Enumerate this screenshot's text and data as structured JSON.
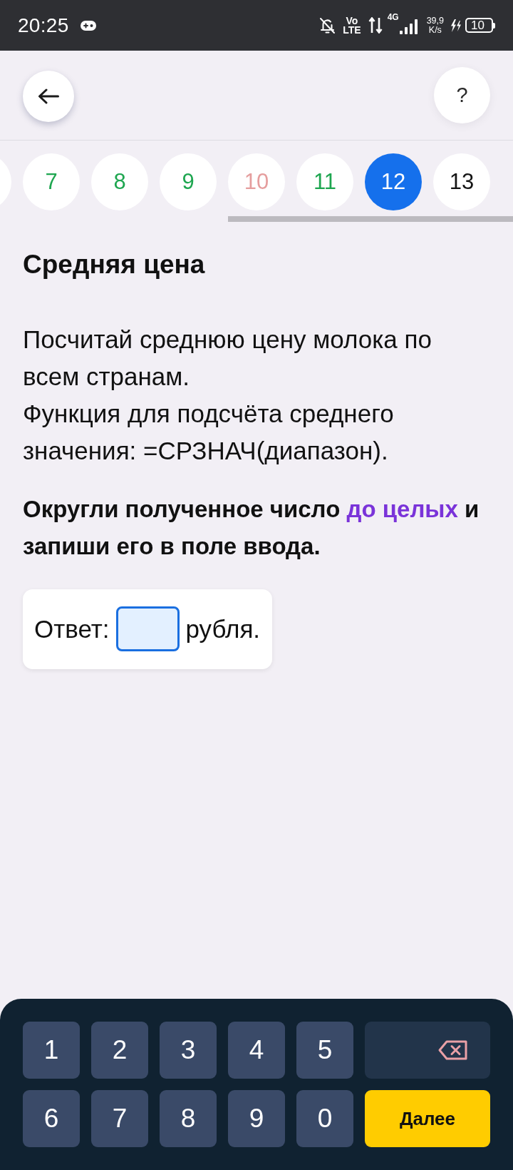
{
  "status_bar": {
    "time": "20:25",
    "volte": [
      "Vo",
      "LTE"
    ],
    "network": "4G",
    "speed": [
      "39,9",
      "K/s"
    ],
    "battery": "10"
  },
  "top_bar": {
    "help_label": "?"
  },
  "tabs": [
    {
      "selected": false
    },
    {
      "label": "7",
      "color": "#1ea650",
      "selected": false
    },
    {
      "label": "8",
      "color": "#1ea650",
      "selected": false
    },
    {
      "label": "9",
      "color": "#1ea650",
      "selected": false
    },
    {
      "label": "10",
      "color": "#e59e9e",
      "selected": false
    },
    {
      "label": "11",
      "color": "#1ea650",
      "selected": false
    },
    {
      "label": "12",
      "selected": true
    },
    {
      "label": "13",
      "color": "#141414",
      "selected": false
    }
  ],
  "task": {
    "title": "Средняя цена",
    "body": [
      "Посчитай среднюю цену молока по всем странам.",
      "Функция для подсчёта среднего значения: =СРЗНАЧ(диапазон)."
    ],
    "instruction": {
      "before": "Округли полученное число ",
      "link": "до целых",
      "after": " и запиши его в поле ввода."
    },
    "answer": {
      "label": "Ответ:",
      "unit": "рубля.",
      "focused": true
    }
  },
  "keypad": [
    {
      "kind": "digit",
      "label": "1"
    },
    {
      "kind": "digit",
      "label": "2"
    },
    {
      "kind": "digit",
      "label": "3"
    },
    {
      "kind": "digit",
      "label": "4"
    },
    {
      "kind": "digit",
      "label": "5"
    },
    {
      "kind": "backspace"
    },
    {
      "kind": "digit",
      "label": "6"
    },
    {
      "kind": "digit",
      "label": "7"
    },
    {
      "kind": "digit",
      "label": "8"
    },
    {
      "kind": "digit",
      "label": "9"
    },
    {
      "kind": "digit",
      "label": "0"
    },
    {
      "kind": "next",
      "label": "Далее"
    }
  ]
}
